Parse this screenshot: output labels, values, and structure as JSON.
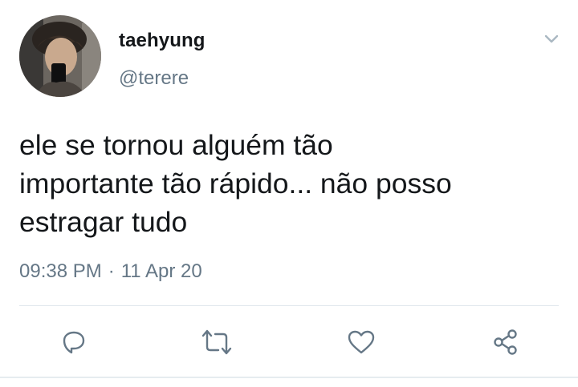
{
  "tweet": {
    "display_name": "taehyung",
    "handle": "@terere",
    "lines": [
      "ele se tornou alguém tão",
      "importante tão rápido... não posso",
      "estragar tudo"
    ],
    "time": "09:38 PM",
    "separator": "·",
    "date": "11 Apr 20"
  },
  "icons": {
    "menu": "chevron-down-icon",
    "reply": "reply-icon",
    "retweet": "retweet-icon",
    "like": "heart-icon",
    "share": "share-icon"
  },
  "colors": {
    "text_primary": "#14171a",
    "text_secondary": "#657786",
    "icon": "#657786",
    "divider": "#e1e8ed"
  }
}
